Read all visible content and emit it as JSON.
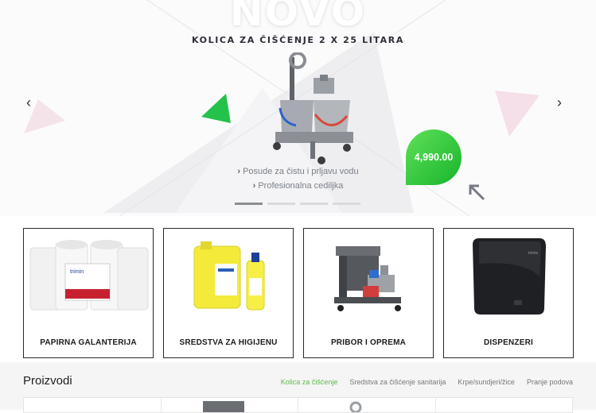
{
  "hero": {
    "headline": "NOVO",
    "subtitle": "KOLICA ZA ČIŠĆENJE 2 X 25 LITARA",
    "features": [
      "Posude za čistu i prljavu vodu",
      "Profesionalna cediljka"
    ],
    "price": "4,990.00",
    "prev_icon": "chevron-left-icon",
    "next_icon": "chevron-right-icon",
    "slides_total": 4,
    "active_slide": 1,
    "colors": {
      "accent_green": "#17b52b",
      "triangle_green": "#22c24a",
      "triangle_pink": "#f3dbe4"
    }
  },
  "categories": [
    {
      "label": "PAPIRNA GALANTERIJA"
    },
    {
      "label": "SREDSTVA ZA HIGIJENU"
    },
    {
      "label": "PRIBOR I OPREMA"
    },
    {
      "label": "DISPENZERI"
    }
  ],
  "products": {
    "title": "Proizvodi",
    "tabs": [
      "Kolica za čišćenje",
      "Sredstva za čišćenje sanitarija",
      "Krpe/sundjeri/žice",
      "Pranje podova"
    ],
    "active_tab": 0,
    "accent": "#5cb84a"
  }
}
